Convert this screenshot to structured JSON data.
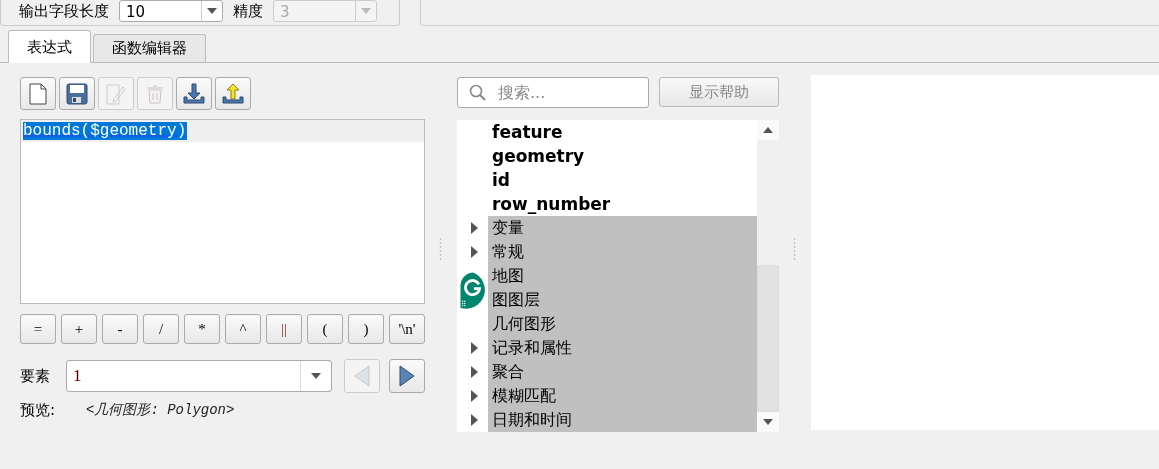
{
  "top_fields": [
    {
      "label": "输出字段长度",
      "value": "10",
      "disabled": false
    },
    {
      "label": "精度",
      "value": "3",
      "disabled": true
    }
  ],
  "tabs": [
    {
      "label": "表达式",
      "selected": true
    },
    {
      "label": "函数编辑器",
      "selected": false
    }
  ],
  "toolbar": [
    {
      "kind": "new",
      "disabled": false
    },
    {
      "kind": "save",
      "disabled": false
    },
    {
      "kind": "edit",
      "disabled": true
    },
    {
      "kind": "delete",
      "disabled": true
    },
    {
      "kind": "import",
      "disabled": false
    },
    {
      "kind": "export",
      "disabled": false
    }
  ],
  "editor": {
    "text": "bounds($geometry)"
  },
  "operators": [
    "=",
    "+",
    "-",
    "/",
    "*",
    "^",
    "||",
    "(",
    ")",
    "'\\n'"
  ],
  "feature": {
    "label": "要素",
    "value": "1",
    "prev_disabled": true,
    "next_disabled": false
  },
  "preview": {
    "label": "预览:",
    "value": "<几何图形: Polygon>"
  },
  "search": {
    "placeholder": "搜索..."
  },
  "help_button": "显示帮助",
  "tree": [
    {
      "label": "feature",
      "kind": "field"
    },
    {
      "label": "geometry",
      "kind": "field"
    },
    {
      "label": "id",
      "kind": "field"
    },
    {
      "label": "row_number",
      "kind": "field"
    },
    {
      "label": "变量",
      "kind": "group",
      "expanded": false
    },
    {
      "label": "常规",
      "kind": "group",
      "expanded": false
    },
    {
      "label": "地图",
      "kind": "group"
    },
    {
      "label": "图图层",
      "kind": "group"
    },
    {
      "label": "几何图形",
      "kind": "group"
    },
    {
      "label": "记录和属性",
      "kind": "group",
      "expanded": false
    },
    {
      "label": "聚合",
      "kind": "group",
      "expanded": false
    },
    {
      "label": "模糊匹配",
      "kind": "group",
      "expanded": false
    },
    {
      "label": "日期和时间",
      "kind": "group",
      "expanded": false
    }
  ]
}
